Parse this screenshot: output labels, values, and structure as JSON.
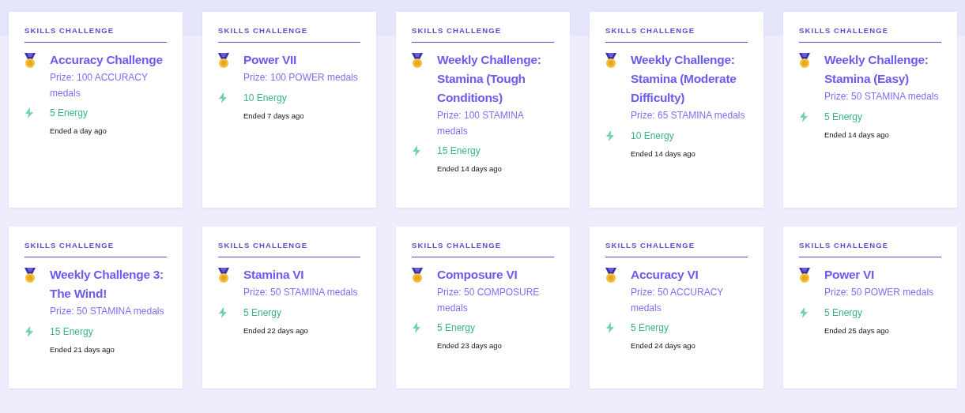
{
  "cards": [
    {
      "category": "SKILLS CHALLENGE",
      "title": "Accuracy Challenge",
      "prize": "Prize: 100 ACCURACY medals",
      "energy": "5 Energy",
      "ended": "Ended a day ago"
    },
    {
      "category": "SKILLS CHALLENGE",
      "title": "Power VII",
      "prize": "Prize: 100 POWER medals",
      "energy": "10 Energy",
      "ended": "Ended 7 days ago"
    },
    {
      "category": "SKILLS CHALLENGE",
      "title": "Weekly Challenge: Stamina (Tough Conditions)",
      "prize": "Prize: 100 STAMINA medals",
      "energy": "15 Energy",
      "ended": "Ended 14 days ago"
    },
    {
      "category": "SKILLS CHALLENGE",
      "title": "Weekly Challenge: Stamina (Moderate Difficulty)",
      "prize": "Prize: 65 STAMINA medals",
      "energy": "10 Energy",
      "ended": "Ended 14 days ago"
    },
    {
      "category": "SKILLS CHALLENGE",
      "title": "Weekly Challenge: Stamina (Easy)",
      "prize": "Prize: 50 STAMINA medals",
      "energy": "5 Energy",
      "ended": "Ended 14 days ago"
    },
    {
      "category": "SKILLS CHALLENGE",
      "title": "Weekly Challenge 3: The Wind!",
      "prize": "Prize: 50 STAMINA medals",
      "energy": "15 Energy",
      "ended": "Ended 21 days ago"
    },
    {
      "category": "SKILLS CHALLENGE",
      "title": "Stamina VI",
      "prize": "Prize: 50 STAMINA medals",
      "energy": "5 Energy",
      "ended": "Ended 22 days ago"
    },
    {
      "category": "SKILLS CHALLENGE",
      "title": "Composure VI",
      "prize": "Prize: 50 COMPOSURE medals",
      "energy": "5 Energy",
      "ended": "Ended 23 days ago"
    },
    {
      "category": "SKILLS CHALLENGE",
      "title": "Accuracy VI",
      "prize": "Prize: 50 ACCURACY medals",
      "energy": "5 Energy",
      "ended": "Ended 24 days ago"
    },
    {
      "category": "SKILLS CHALLENGE",
      "title": "Power VI",
      "prize": "Prize: 50 POWER medals",
      "energy": "5 Energy",
      "ended": "Ended 25 days ago"
    }
  ]
}
